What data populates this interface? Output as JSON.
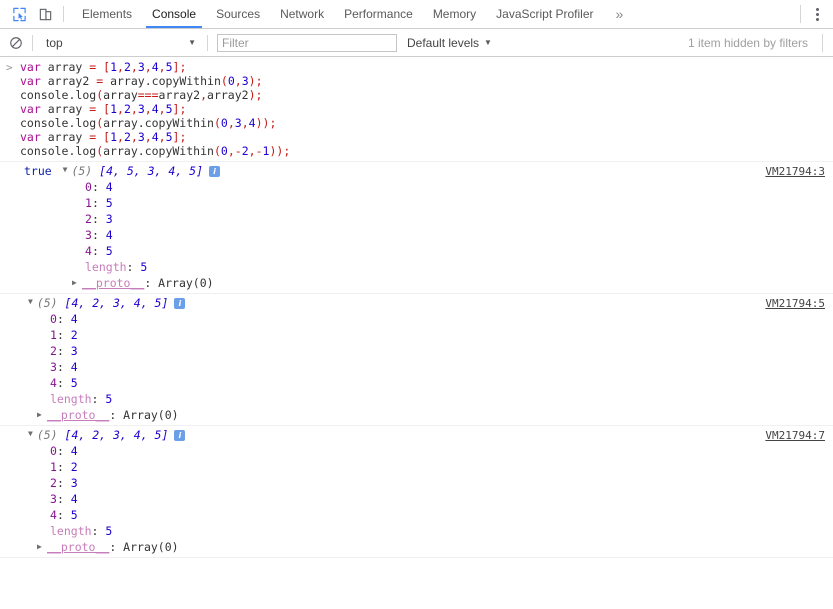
{
  "tabbar": {
    "icons": [
      {
        "name": "inspect-element-icon",
        "title": "Inspect"
      },
      {
        "name": "device-toolbar-icon",
        "title": "Toggle device toolbar"
      }
    ],
    "tabs": [
      {
        "label": "Elements",
        "active": false
      },
      {
        "label": "Console",
        "active": true
      },
      {
        "label": "Sources",
        "active": false
      },
      {
        "label": "Network",
        "active": false
      },
      {
        "label": "Performance",
        "active": false
      },
      {
        "label": "Memory",
        "active": false
      },
      {
        "label": "JavaScript Profiler",
        "active": false
      }
    ],
    "more_label": "»",
    "menu_name": "more-options-icon"
  },
  "toolbar": {
    "clear_icon": "clear-console-icon",
    "context_value": "top",
    "filter_placeholder": "Filter",
    "filter_value": "",
    "levels_label": "Default levels",
    "hidden_message": "1 item hidden by filters"
  },
  "console": {
    "prompt_glyph": ">",
    "input_lines": [
      [
        {
          "t": "var",
          "c": "kw"
        },
        {
          "t": " ",
          "c": "pln"
        },
        {
          "t": "array",
          "c": "idt"
        },
        {
          "t": " ",
          "c": "pln"
        },
        {
          "t": "=",
          "c": "pun"
        },
        {
          "t": " ",
          "c": "pln"
        },
        {
          "t": "[",
          "c": "pun"
        },
        {
          "t": "1",
          "c": "num"
        },
        {
          "t": ",",
          "c": "pun"
        },
        {
          "t": "2",
          "c": "num"
        },
        {
          "t": ",",
          "c": "pun"
        },
        {
          "t": "3",
          "c": "num"
        },
        {
          "t": ",",
          "c": "pun"
        },
        {
          "t": "4",
          "c": "num"
        },
        {
          "t": ",",
          "c": "pun"
        },
        {
          "t": "5",
          "c": "num"
        },
        {
          "t": "]",
          "c": "pun"
        },
        {
          "t": ";",
          "c": "pun"
        }
      ],
      [
        {
          "t": "var",
          "c": "kw"
        },
        {
          "t": " ",
          "c": "pln"
        },
        {
          "t": "array2",
          "c": "idt"
        },
        {
          "t": " ",
          "c": "pln"
        },
        {
          "t": "=",
          "c": "pun"
        },
        {
          "t": " ",
          "c": "pln"
        },
        {
          "t": "array",
          "c": "idt"
        },
        {
          "t": ".",
          "c": "pln"
        },
        {
          "t": "copyWithin",
          "c": "idt"
        },
        {
          "t": "(",
          "c": "pun"
        },
        {
          "t": "0",
          "c": "num"
        },
        {
          "t": ",",
          "c": "pun"
        },
        {
          "t": "3",
          "c": "num"
        },
        {
          "t": ")",
          "c": "pun"
        },
        {
          "t": ";",
          "c": "pun"
        }
      ],
      [
        {
          "t": "console",
          "c": "idt"
        },
        {
          "t": ".",
          "c": "pln"
        },
        {
          "t": "log",
          "c": "idt"
        },
        {
          "t": "(",
          "c": "pun"
        },
        {
          "t": "array",
          "c": "idt"
        },
        {
          "t": "===",
          "c": "pun"
        },
        {
          "t": "array2",
          "c": "idt"
        },
        {
          "t": ",",
          "c": "pun"
        },
        {
          "t": "array2",
          "c": "idt"
        },
        {
          "t": ")",
          "c": "pun"
        },
        {
          "t": ";",
          "c": "pun"
        }
      ],
      [
        {
          "t": "var",
          "c": "kw"
        },
        {
          "t": " ",
          "c": "pln"
        },
        {
          "t": "array",
          "c": "idt"
        },
        {
          "t": " ",
          "c": "pln"
        },
        {
          "t": "=",
          "c": "pun"
        },
        {
          "t": " ",
          "c": "pln"
        },
        {
          "t": "[",
          "c": "pun"
        },
        {
          "t": "1",
          "c": "num"
        },
        {
          "t": ",",
          "c": "pun"
        },
        {
          "t": "2",
          "c": "num"
        },
        {
          "t": ",",
          "c": "pun"
        },
        {
          "t": "3",
          "c": "num"
        },
        {
          "t": ",",
          "c": "pun"
        },
        {
          "t": "4",
          "c": "num"
        },
        {
          "t": ",",
          "c": "pun"
        },
        {
          "t": "5",
          "c": "num"
        },
        {
          "t": "]",
          "c": "pun"
        },
        {
          "t": ";",
          "c": "pun"
        }
      ],
      [
        {
          "t": "console",
          "c": "idt"
        },
        {
          "t": ".",
          "c": "pln"
        },
        {
          "t": "log",
          "c": "idt"
        },
        {
          "t": "(",
          "c": "pun"
        },
        {
          "t": "array",
          "c": "idt"
        },
        {
          "t": ".",
          "c": "pln"
        },
        {
          "t": "copyWithin",
          "c": "idt"
        },
        {
          "t": "(",
          "c": "pun"
        },
        {
          "t": "0",
          "c": "num"
        },
        {
          "t": ",",
          "c": "pun"
        },
        {
          "t": "3",
          "c": "num"
        },
        {
          "t": ",",
          "c": "pun"
        },
        {
          "t": "4",
          "c": "num"
        },
        {
          "t": ")",
          "c": "pun"
        },
        {
          "t": ")",
          "c": "pun"
        },
        {
          "t": ";",
          "c": "pun"
        }
      ],
      [
        {
          "t": "var",
          "c": "kw"
        },
        {
          "t": " ",
          "c": "pln"
        },
        {
          "t": "array",
          "c": "idt"
        },
        {
          "t": " ",
          "c": "pln"
        },
        {
          "t": "=",
          "c": "pun"
        },
        {
          "t": " ",
          "c": "pln"
        },
        {
          "t": "[",
          "c": "pun"
        },
        {
          "t": "1",
          "c": "num"
        },
        {
          "t": ",",
          "c": "pun"
        },
        {
          "t": "2",
          "c": "num"
        },
        {
          "t": ",",
          "c": "pun"
        },
        {
          "t": "3",
          "c": "num"
        },
        {
          "t": ",",
          "c": "pun"
        },
        {
          "t": "4",
          "c": "num"
        },
        {
          "t": ",",
          "c": "pun"
        },
        {
          "t": "5",
          "c": "num"
        },
        {
          "t": "]",
          "c": "pun"
        },
        {
          "t": ";",
          "c": "pun"
        }
      ],
      [
        {
          "t": "console",
          "c": "idt"
        },
        {
          "t": ".",
          "c": "pln"
        },
        {
          "t": "log",
          "c": "idt"
        },
        {
          "t": "(",
          "c": "pun"
        },
        {
          "t": "array",
          "c": "idt"
        },
        {
          "t": ".",
          "c": "pln"
        },
        {
          "t": "copyWithin",
          "c": "idt"
        },
        {
          "t": "(",
          "c": "pun"
        },
        {
          "t": "0",
          "c": "num"
        },
        {
          "t": ",",
          "c": "pun"
        },
        {
          "t": "-",
          "c": "pun"
        },
        {
          "t": "2",
          "c": "num"
        },
        {
          "t": ",",
          "c": "pun"
        },
        {
          "t": "-",
          "c": "pun"
        },
        {
          "t": "1",
          "c": "num"
        },
        {
          "t": ")",
          "c": "pun"
        },
        {
          "t": ")",
          "c": "pun"
        },
        {
          "t": ";",
          "c": "pun"
        }
      ]
    ],
    "outputs": [
      {
        "bool_prefix": "true",
        "toggle_glyph": "▼",
        "length_label": "(5)",
        "preview": "[4, 5, 3, 4, 5]",
        "info_glyph": "i",
        "source": "VM21794:3",
        "prop_indent": 85,
        "proto_indent": 72,
        "props": [
          {
            "key": "0",
            "value": "4"
          },
          {
            "key": "1",
            "value": "5"
          },
          {
            "key": "2",
            "value": "3"
          },
          {
            "key": "3",
            "value": "4"
          },
          {
            "key": "4",
            "value": "5"
          }
        ],
        "length_key": "length",
        "length_value": "5",
        "proto_key": "__proto__",
        "proto_value": "Array(0)",
        "proto_glyph": "▶"
      },
      {
        "bool_prefix": "",
        "toggle_glyph": "▼",
        "length_label": "(5)",
        "preview": "[4, 2, 3, 4, 5]",
        "info_glyph": "i",
        "source": "VM21794:5",
        "prop_indent": 50,
        "proto_indent": 37,
        "props": [
          {
            "key": "0",
            "value": "4"
          },
          {
            "key": "1",
            "value": "2"
          },
          {
            "key": "2",
            "value": "3"
          },
          {
            "key": "3",
            "value": "4"
          },
          {
            "key": "4",
            "value": "5"
          }
        ],
        "length_key": "length",
        "length_value": "5",
        "proto_key": "__proto__",
        "proto_value": "Array(0)",
        "proto_glyph": "▶"
      },
      {
        "bool_prefix": "",
        "toggle_glyph": "▼",
        "length_label": "(5)",
        "preview": "[4, 2, 3, 4, 5]",
        "info_glyph": "i",
        "source": "VM21794:7",
        "prop_indent": 50,
        "proto_indent": 37,
        "props": [
          {
            "key": "0",
            "value": "4"
          },
          {
            "key": "1",
            "value": "2"
          },
          {
            "key": "2",
            "value": "3"
          },
          {
            "key": "3",
            "value": "4"
          },
          {
            "key": "4",
            "value": "5"
          }
        ],
        "length_key": "length",
        "length_value": "5",
        "proto_key": "__proto__",
        "proto_value": "Array(0)",
        "proto_glyph": "▶"
      }
    ]
  },
  "colors": {
    "accent": "#4285f4",
    "keyword": "#aa0d91",
    "number": "#1c00cf",
    "punctuation": "#c41a16",
    "property": "#881391",
    "info_badge": "#6b9fe8"
  }
}
